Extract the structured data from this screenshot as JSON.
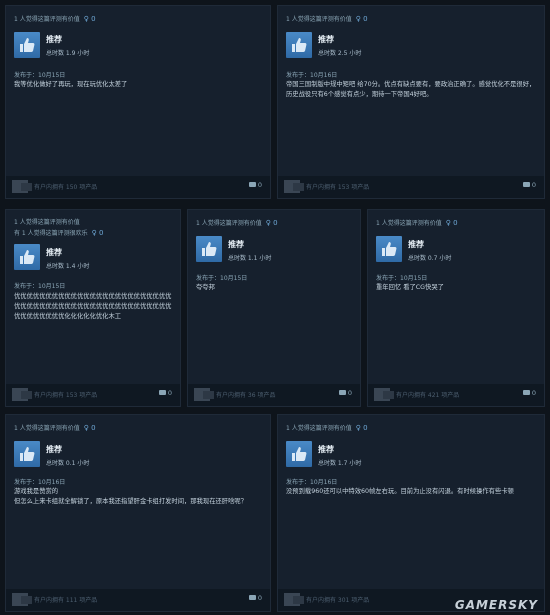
{
  "reviews": [
    {
      "helpful_lines": [
        "1 人觉得这篇评测有价值"
      ],
      "awards": "0",
      "recommend": "推荐",
      "hours": "总时数 1.9 小时",
      "posted": "发布于：10月15日",
      "body": "我等优化做好了再玩，现在玩优化太差了",
      "footer": "有户内拥有 150 项产品",
      "comments": "0"
    },
    {
      "helpful_lines": [
        "1 人觉得这篇评测有价值"
      ],
      "awards": "0",
      "recommend": "推荐",
      "hours": "总时数 2.5 小时",
      "posted": "发布于：10月16日",
      "body": "帝国三国制版中规中矩吧 给70分。优点有缺点要有，要政治正确了。感觉优化不是很好，历史战役只有6个感觉有点少，期待一下帝国4好吧。",
      "footer": "有户内拥有 153 项产品",
      "comments": "0"
    },
    {
      "helpful_lines": [
        "1 人觉得这篇评测有价值",
        "有 1 人觉得这篇评测很欢乐"
      ],
      "awards": "0",
      "recommend": "推荐",
      "hours": "总时数 1.4 小时",
      "posted": "发布于：10月15日",
      "body": "优优优优优优优优优优优优优优优优优优优优优优优优优优优优优优优优优优优优优优优优优优优优优优优优优优优优优优优优优优化化化化化优化木工",
      "footer": "有户内拥有 153 项产品",
      "comments": "0"
    },
    {
      "helpful_lines": [
        "1 人觉得这篇评测有价值"
      ],
      "awards": "0",
      "recommend": "推荐",
      "hours": "总时数 1.1 小时",
      "posted": "发布于：10月15日",
      "body": "夸夸邦",
      "footer": "有户内拥有 36 项产品",
      "comments": "0"
    },
    {
      "helpful_lines": [
        "1 人觉得这篇评测有价值"
      ],
      "awards": "0",
      "recommend": "推荐",
      "hours": "总时数 0.7 小时",
      "posted": "发布于：10月15日",
      "body": "重年回忆 看了CG快哭了",
      "footer": "有户内拥有 421 项产品",
      "comments": "0"
    },
    {
      "helpful_lines": [
        "1 人觉得这篇评测有价值"
      ],
      "awards": "0",
      "recommend": "推荐",
      "hours": "总时数 0.1 小时",
      "posted": "发布于：10月16日",
      "body": "游戏我是赞赏的\n但怎么上来卡组就全解锁了，原本我还指望肝金卡组打发时间，那我现在还肝啥呢？",
      "footer": "有户内拥有 111 项产品",
      "comments": "0"
    },
    {
      "helpful_lines": [
        "1 人觉得这篇评测有价值"
      ],
      "awards": "0",
      "recommend": "推荐",
      "hours": "总时数 1.7 小时",
      "posted": "发布于：10月16日",
      "body": "没预到载960还可以中特效60帧左右玩。目前为止没有闪退。有时候操作有些卡顿",
      "footer": "有户内拥有 301 项产品",
      "comments": "0"
    }
  ],
  "watermark": "GAMERSKY"
}
